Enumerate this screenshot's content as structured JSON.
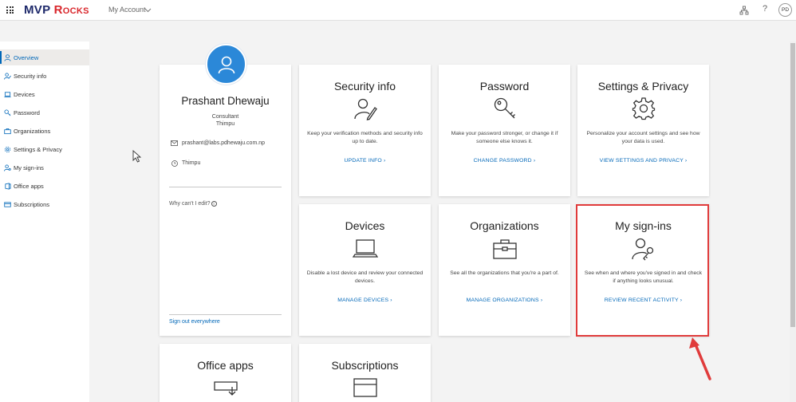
{
  "header": {
    "brand_part1": "MVP ",
    "brand_part2": "Rocks",
    "app_title": "My Account",
    "help": "?",
    "avatar_initials": "PD"
  },
  "sidebar": {
    "items": [
      {
        "label": "Overview",
        "icon": "person-icon",
        "active": true
      },
      {
        "label": "Security info",
        "icon": "security-person-icon"
      },
      {
        "label": "Devices",
        "icon": "laptop-icon"
      },
      {
        "label": "Password",
        "icon": "key-icon"
      },
      {
        "label": "Organizations",
        "icon": "briefcase-icon"
      },
      {
        "label": "Settings & Privacy",
        "icon": "gear-icon"
      },
      {
        "label": "My sign-ins",
        "icon": "signin-person-icon"
      },
      {
        "label": "Office apps",
        "icon": "office-icon"
      },
      {
        "label": "Subscriptions",
        "icon": "card-icon"
      }
    ]
  },
  "profile": {
    "name": "Prashant Dhewaju",
    "role": "Consultant",
    "location_top": "Thimpu",
    "email": "prashant@labs.pdhewaju.com.np",
    "location": "Thimpu",
    "why_edit": "Why can't I edit?",
    "sign_out": "Sign out everywhere"
  },
  "tiles": {
    "security": {
      "title": "Security info",
      "desc": "Keep your verification methods and security info up to date.",
      "link": "UPDATE INFO  ›"
    },
    "password": {
      "title": "Password",
      "desc": "Make your password stronger, or change it if someone else knows it.",
      "link": "CHANGE PASSWORD  ›"
    },
    "settings": {
      "title": "Settings & Privacy",
      "desc": "Personalize your account settings and see how your data is used.",
      "link": "VIEW SETTINGS AND PRIVACY  ›"
    },
    "devices": {
      "title": "Devices",
      "desc": "Disable a lost device and review your connected devices.",
      "link": "MANAGE DEVICES  ›"
    },
    "organizations": {
      "title": "Organizations",
      "desc": "See all the organizations that you're a part of.",
      "link": "MANAGE ORGANIZATIONS  ›"
    },
    "signins": {
      "title": "My sign-ins",
      "desc": "See when and where you've signed in and check if anything looks unusual.",
      "link": "REVIEW RECENT ACTIVITY  ›"
    },
    "office": {
      "title": "Office apps"
    },
    "subscriptions": {
      "title": "Subscriptions"
    }
  },
  "colors": {
    "accent": "#0067b8",
    "avatar_bg": "#2b88d8",
    "highlight": "#e03b3b",
    "brand_navy": "#1f2a6b",
    "brand_red": "#d9262b"
  }
}
